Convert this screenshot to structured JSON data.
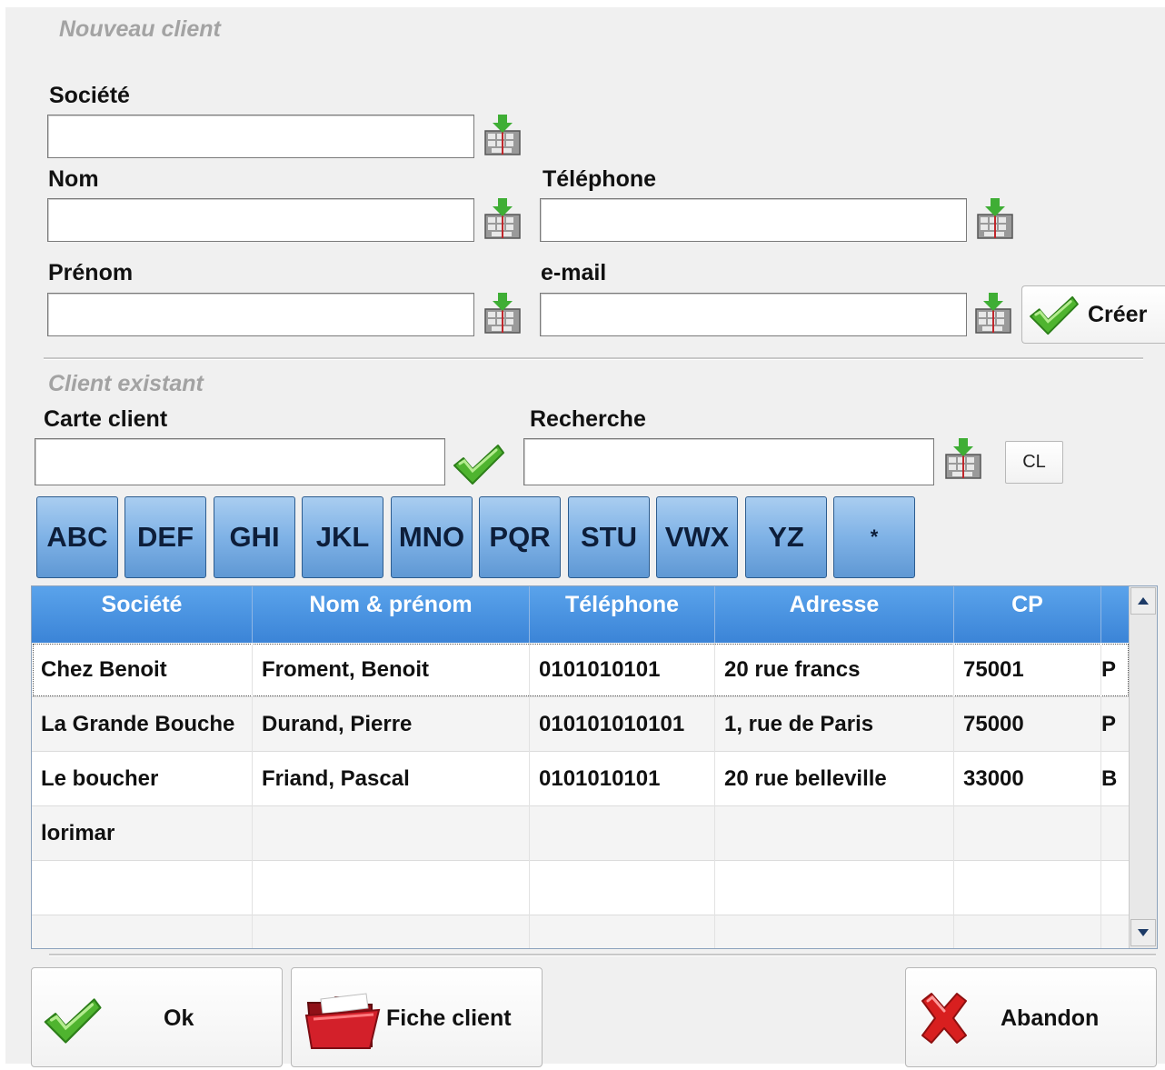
{
  "new_client": {
    "title": "Nouveau client",
    "societe_label": "Société",
    "nom_label": "Nom",
    "telephone_label": "Téléphone",
    "prenom_label": "Prénom",
    "email_label": "e-mail",
    "societe_value": "",
    "nom_value": "",
    "telephone_value": "",
    "prenom_value": "",
    "email_value": "",
    "create_button": "Créer"
  },
  "existing_client": {
    "title": "Client existant",
    "carte_label": "Carte client",
    "recherche_label": "Recherche",
    "carte_value": "",
    "recherche_value": "",
    "clear_button": "CL"
  },
  "alpha_filters": [
    "ABC",
    "DEF",
    "GHI",
    "JKL",
    "MNO",
    "PQR",
    "STU",
    "VWX",
    "YZ",
    "*"
  ],
  "table": {
    "columns": [
      "Société",
      "Nom & prénom",
      "Téléphone",
      "Adresse",
      "CP",
      ""
    ],
    "rows": [
      [
        "Chez Benoit",
        "Froment, Benoit",
        "0101010101",
        "20 rue francs",
        "75001",
        "P"
      ],
      [
        "La Grande Bouche",
        "Durand, Pierre",
        "010101010101",
        "1, rue de Paris",
        "75000",
        "P"
      ],
      [
        "Le boucher",
        "Friand, Pascal",
        "0101010101",
        "20 rue belleville",
        "33000",
        "B"
      ],
      [
        "lorimar",
        "",
        "",
        "",
        "",
        ""
      ],
      [
        "",
        "",
        "",
        "",
        "",
        ""
      ],
      [
        "",
        "",
        "",
        "",
        "",
        ""
      ]
    ]
  },
  "footer": {
    "ok_button": "Ok",
    "fiche_button": "Fiche client",
    "abandon_button": "Abandon"
  },
  "icons": {
    "keyboard": "keyboard-icon",
    "check": "check-icon",
    "folder": "folder-icon",
    "cross": "cross-icon"
  },
  "colors": {
    "accent_blue": "#4a94e0",
    "check_green": "#4fb42f",
    "cross_red": "#d81f1f",
    "folder_red": "#c8202a"
  }
}
